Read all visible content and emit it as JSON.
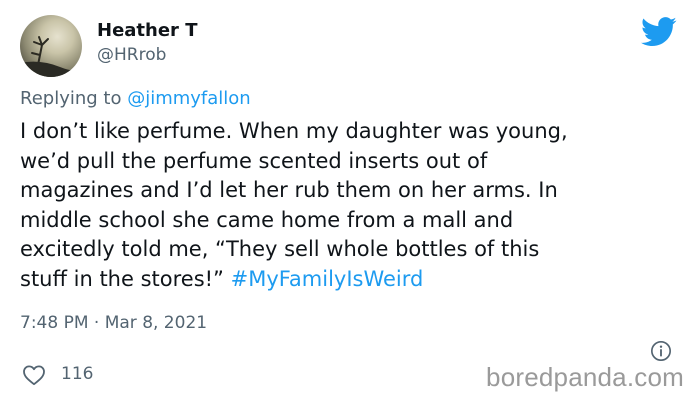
{
  "author": {
    "display_name": "Heather T",
    "handle": "@HRrob"
  },
  "reply": {
    "prefix": "Replying to ",
    "mention": "@jimmyfallon"
  },
  "tweet": {
    "lines": [
      "I don’t like perfume. When my daughter was young,",
      "we’d pull the perfume scented inserts out of",
      "magazines and I’d let her rub them on her arms. In",
      "middle school she came home from a mall and",
      "excitedly told me, “They sell whole bottles of this"
    ],
    "last_line_text": "stuff in the stores!” ",
    "hashtag": "#MyFamilyIsWeird",
    "timestamp": "7:48 PM · Mar 8, 2021"
  },
  "engagement": {
    "likes": "116"
  },
  "watermark": "boredpanda.com",
  "icons": {
    "logo": "twitter-bird-icon",
    "info": "info-icon",
    "like": "heart-icon"
  },
  "colors": {
    "accent": "#1d9bf0",
    "secondary_text": "#536471",
    "primary_text": "#0f1419",
    "watermark": "#9a9a9a"
  }
}
